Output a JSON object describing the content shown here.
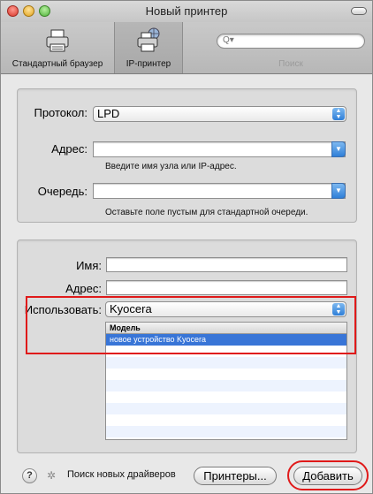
{
  "window": {
    "title": "Новый принтер"
  },
  "toolbar": {
    "items": [
      {
        "label": "Стандартный браузер",
        "icon": "printer-browser-icon"
      },
      {
        "label": "IP-принтер",
        "icon": "ip-printer-icon"
      }
    ],
    "search": {
      "placeholder": "Q▾",
      "label": "Поиск"
    }
  },
  "connection": {
    "protocol_label": "Протокол:",
    "protocol_value": "LPD",
    "address_label": "Адрес:",
    "address_value": "",
    "address_hint": "Введите имя узла или IP-адрес.",
    "queue_label": "Очередь:",
    "queue_value": "",
    "queue_hint": "Оставьте поле пустым для стандартной очереди."
  },
  "printer": {
    "name_label": "Имя:",
    "name_value": "",
    "address_label": "Адрес:",
    "address_value": "",
    "use_label": "Использовать:",
    "use_value": "Kyocera",
    "model_header": "Модель",
    "models": [
      "новое устройство Kyocera"
    ]
  },
  "footer": {
    "help": "?",
    "search_drivers": "Поиск новых драйверов",
    "printers_button": "Принтеры...",
    "add_button": "Добавить"
  },
  "colors": {
    "highlight_red": "#e01a1a",
    "selection_blue": "#3875d7",
    "aqua_blue": "#2f7fd8"
  }
}
